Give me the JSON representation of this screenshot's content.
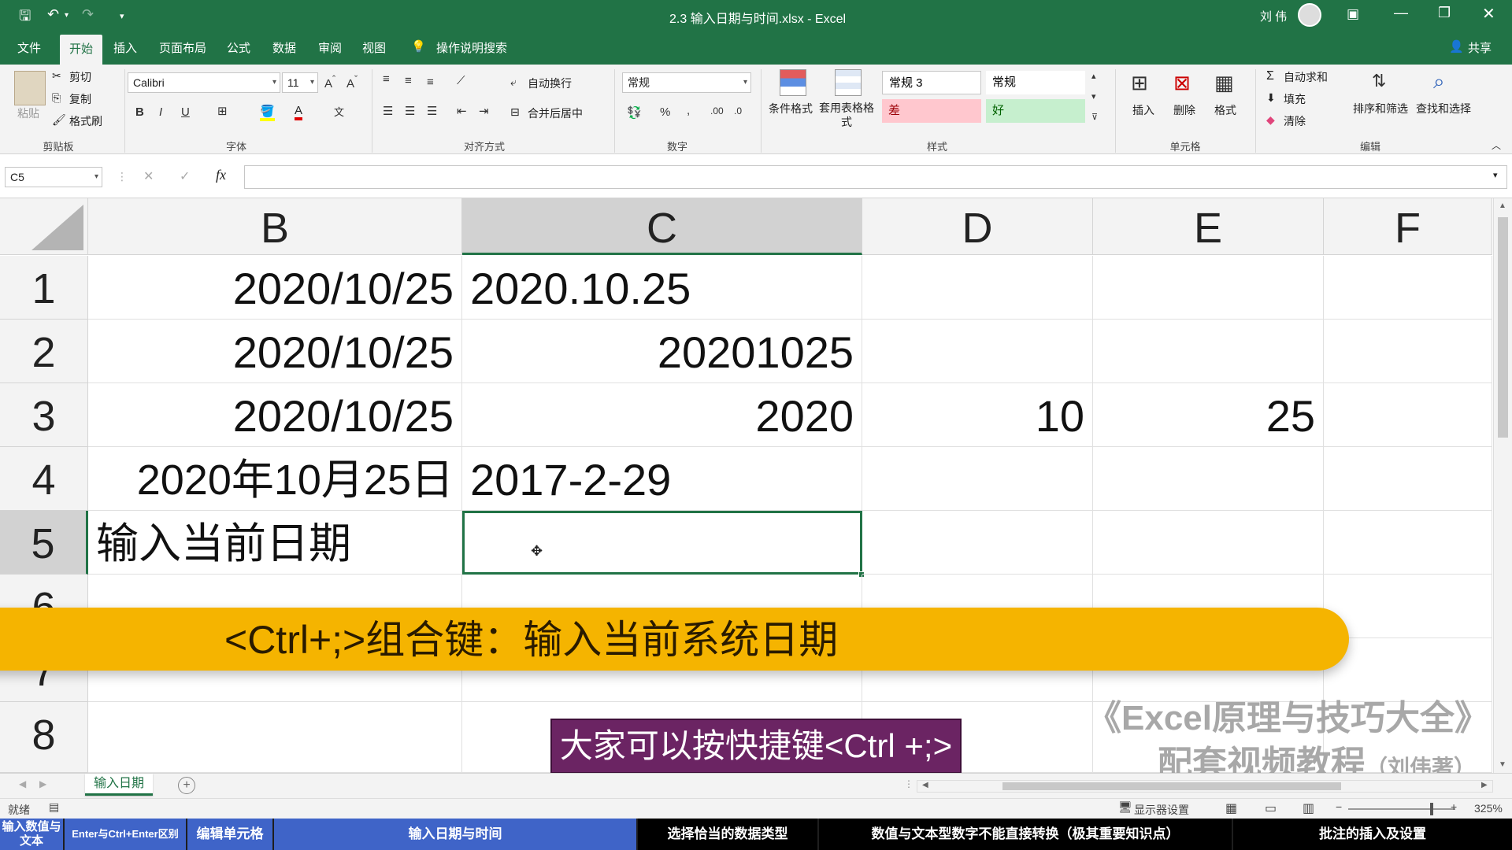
{
  "window": {
    "title": "2.3 输入日期与时间.xlsx - Excel",
    "user": "刘 伟",
    "share_label": "共享"
  },
  "menu": {
    "tabs": [
      "文件",
      "开始",
      "插入",
      "页面布局",
      "公式",
      "数据",
      "审阅",
      "视图"
    ],
    "active_tab": "开始",
    "tell_me": "操作说明搜索"
  },
  "ribbon": {
    "clipboard": {
      "label": "剪贴板",
      "paste": "粘贴",
      "cut": "剪切",
      "copy": "复制",
      "format_painter": "格式刷"
    },
    "font": {
      "label": "字体",
      "name": "Calibri",
      "size": "11",
      "bold": "B",
      "italic": "I",
      "underline": "U"
    },
    "alignment": {
      "label": "对齐方式",
      "wrap": "自动换行",
      "merge": "合并后居中"
    },
    "number": {
      "label": "数字",
      "format": "常规",
      "percent": "%",
      "comma": ","
    },
    "styles": {
      "label": "样式",
      "conditional": "条件格式",
      "table": "套用表格格式",
      "normal3": "常规 3",
      "normal": "常规",
      "bad": "差",
      "good": "好"
    },
    "cells": {
      "label": "单元格",
      "insert": "插入",
      "delete": "删除",
      "format": "格式"
    },
    "editing": {
      "label": "编辑",
      "autosum": "自动求和",
      "fill": "填充",
      "clear": "清除",
      "sort": "排序和筛选",
      "find": "查找和选择"
    }
  },
  "formula_bar": {
    "name_box": "C5",
    "fx": "fx",
    "value": ""
  },
  "grid": {
    "columns": [
      "B",
      "C",
      "D",
      "E",
      "F"
    ],
    "selected_column": "C",
    "rows": [
      {
        "num": "1",
        "B": "2020/10/25",
        "C": "2020.10.25",
        "D": "",
        "E": ""
      },
      {
        "num": "2",
        "B": "2020/10/25",
        "C": "20201025",
        "D": "",
        "E": ""
      },
      {
        "num": "3",
        "B": "2020/10/25",
        "C": "2020",
        "D": "10",
        "E": "25"
      },
      {
        "num": "4",
        "B": "2020年10月25日",
        "C": "2017-2-29",
        "D": "",
        "E": ""
      },
      {
        "num": "5",
        "B": "输入当前日期",
        "C": "",
        "D": "",
        "E": ""
      },
      {
        "num": "6"
      },
      {
        "num": "7"
      },
      {
        "num": "8"
      }
    ],
    "selected_row": "5"
  },
  "overlay": {
    "banner": "<Ctrl+;>组合键：输入当前系统日期",
    "subtitle": "大家可以按快捷键<Ctrl +;>",
    "watermark_line1": "《Excel原理与技巧大全》",
    "watermark_line2": "配套视频教程",
    "watermark_author": "（刘伟著）"
  },
  "sheet": {
    "tab": "输入日期",
    "add": "+"
  },
  "status": {
    "ready": "就绪",
    "display_settings": "显示器设置",
    "zoom": "325%"
  },
  "chapters": [
    {
      "label": "输入数值与文本",
      "style": "blue"
    },
    {
      "label": "Enter与Ctrl+Enter区别",
      "style": "blue"
    },
    {
      "label": "编辑单元格",
      "style": "blue"
    },
    {
      "label": "输入日期与时间",
      "style": "blue"
    },
    {
      "label": "选择恰当的数据类型",
      "style": "dark"
    },
    {
      "label": "数值与文本型数字不能直接转换（极其重要知识点）",
      "style": "dark"
    },
    {
      "label": "批注的插入及设置",
      "style": "dark"
    }
  ],
  "colors": {
    "excel_green": "#217346",
    "banner": "#f5b400",
    "subtitle_bg": "#6b2463",
    "chapter_active": "#3f64c8"
  }
}
